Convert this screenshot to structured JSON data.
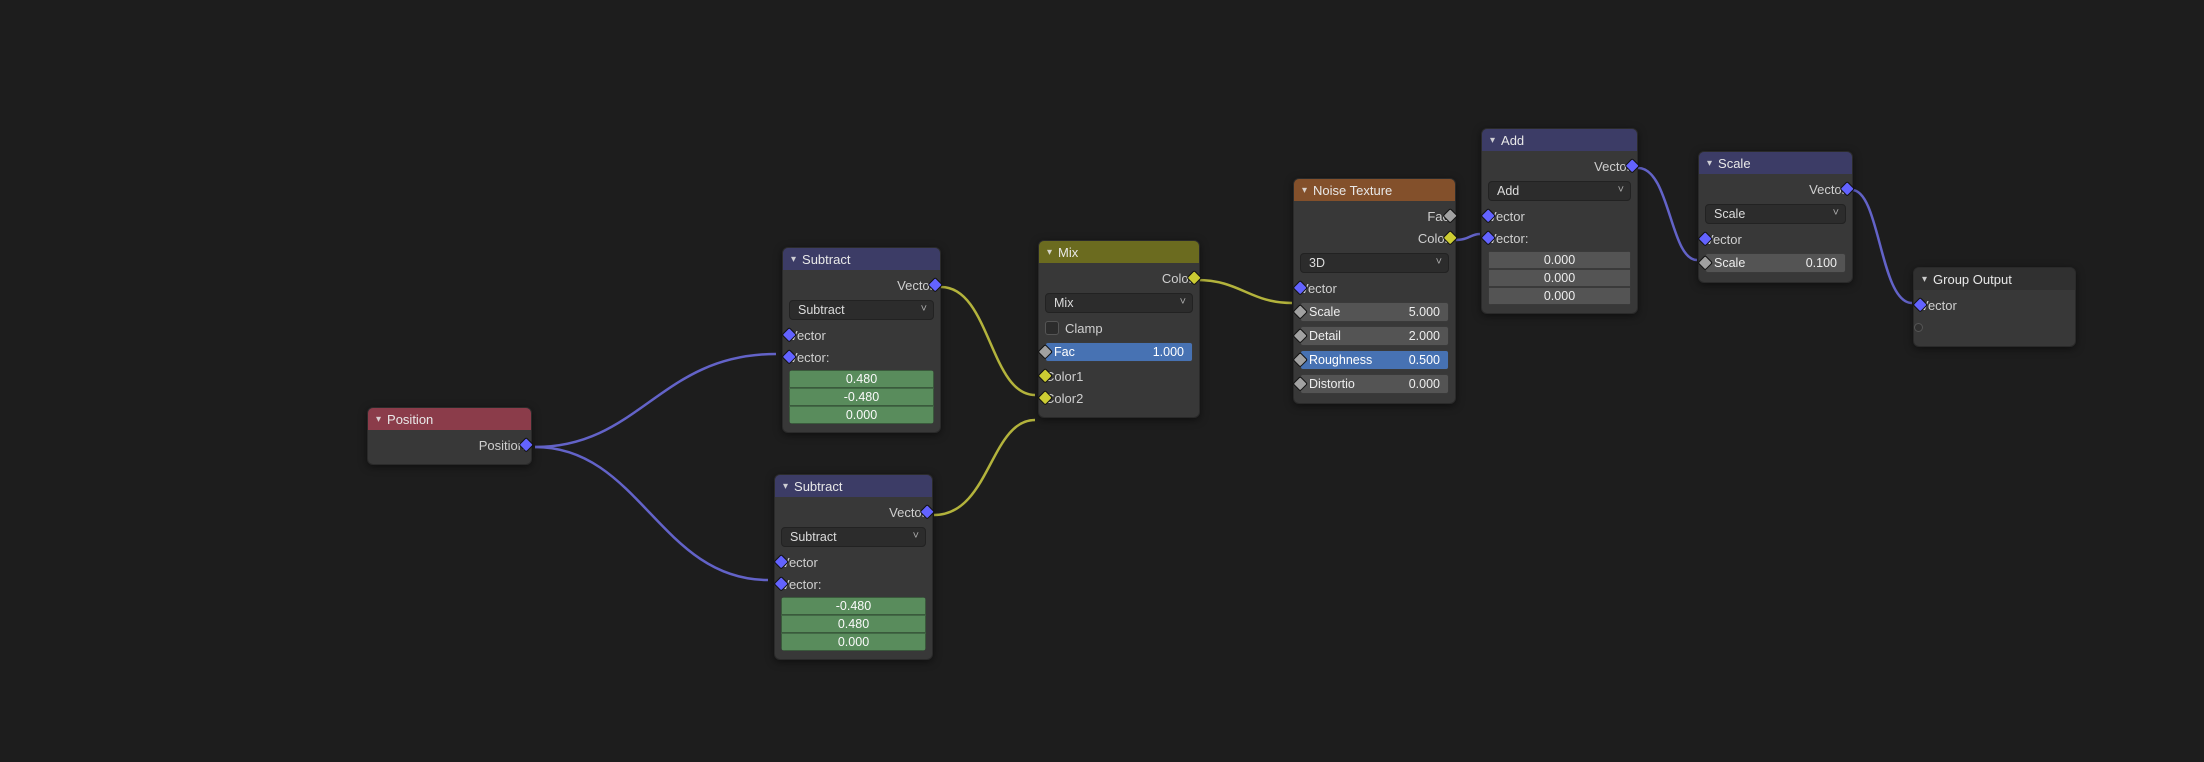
{
  "position": {
    "title": "Position",
    "out": "Position"
  },
  "subtract1": {
    "title": "Subtract",
    "out": "Vector",
    "op": "Subtract",
    "inVector": "Vector",
    "vecLabel": "Vector:",
    "v": [
      "0.480",
      "-0.480",
      "0.000"
    ]
  },
  "subtract2": {
    "title": "Subtract",
    "out": "Vector",
    "op": "Subtract",
    "inVector": "Vector",
    "vecLabel": "Vector:",
    "v": [
      "-0.480",
      "0.480",
      "0.000"
    ]
  },
  "mix": {
    "title": "Mix",
    "out": "Color",
    "blend": "Mix",
    "clamp": "Clamp",
    "facLabel": "Fac",
    "facVal": "1.000",
    "c1": "Color1",
    "c2": "Color2"
  },
  "noise": {
    "title": "Noise Texture",
    "outFac": "Fac",
    "outColor": "Color",
    "dims": "3D",
    "inVector": "Vector",
    "scaleLabel": "Scale",
    "scaleVal": "5.000",
    "detailLabel": "Detail",
    "detailVal": "2.000",
    "roughLabel": "Roughness",
    "roughVal": "0.500",
    "distLabel": "Distortio",
    "distVal": "0.000"
  },
  "add": {
    "title": "Add",
    "out": "Vector",
    "op": "Add",
    "inVector": "Vector",
    "vecLabel": "Vector:",
    "v": [
      "0.000",
      "0.000",
      "0.000"
    ]
  },
  "scale": {
    "title": "Scale",
    "out": "Vector",
    "op": "Scale",
    "inVector": "Vector",
    "scaleLabel": "Scale",
    "scaleVal": "0.100"
  },
  "output": {
    "title": "Group Output",
    "in": "Vector"
  }
}
